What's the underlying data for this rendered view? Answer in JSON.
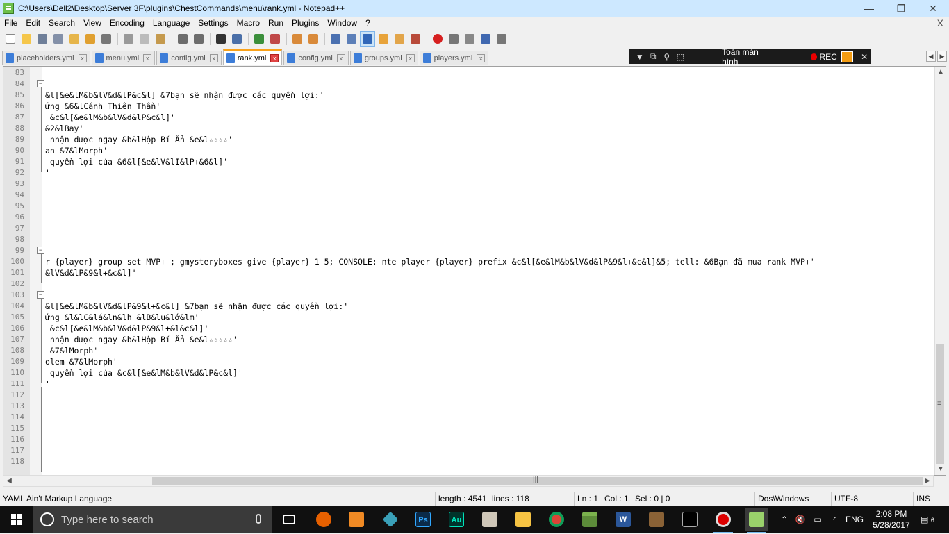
{
  "window": {
    "title": "C:\\Users\\Dell2\\Desktop\\Server 3F\\plugins\\ChestCommands\\menu\\rank.yml - Notepad++",
    "minimize": "—",
    "restore": "❐",
    "close": "✕"
  },
  "menu": [
    "File",
    "Edit",
    "Search",
    "View",
    "Encoding",
    "Language",
    "Settings",
    "Macro",
    "Run",
    "Plugins",
    "Window",
    "?"
  ],
  "menu_close": "X",
  "tabs": [
    {
      "label": "placeholders.yml",
      "active": false
    },
    {
      "label": "menu.yml",
      "active": false
    },
    {
      "label": "config.yml",
      "active": false
    },
    {
      "label": "rank.yml",
      "active": true
    },
    {
      "label": "config.yml",
      "active": false
    },
    {
      "label": "groups.yml",
      "active": false
    },
    {
      "label": "players.yml",
      "active": false
    }
  ],
  "tab_close_glyph": "x",
  "recorder": {
    "fullscreen_label": "Toàn màn hình",
    "rec_label": "REC",
    "close": "✕"
  },
  "editor": {
    "lines": [
      {
        "n": "83",
        "t": ""
      },
      {
        "n": "84",
        "t": ""
      },
      {
        "n": "85",
        "t": "&l[&e&lM&b&lV&d&lP&c&l] &7bạn sẽ nhận được các quyền lợi:'"
      },
      {
        "n": "86",
        "t": "ứng &6&lCánh Thiên Thần'"
      },
      {
        "n": "87",
        "t": " &c&l[&e&lM&b&lV&d&lP&c&l]'"
      },
      {
        "n": "88",
        "t": "&2&lBay'"
      },
      {
        "n": "89",
        "t": " nhận được ngay &b&lHộp Bí Ẩn &e&l☆☆☆☆'"
      },
      {
        "n": "90",
        "t": "an &7&lMorph'"
      },
      {
        "n": "91",
        "t": " quyền lợi của &6&l[&e&lV&lI&lP+&6&l]'"
      },
      {
        "n": "92",
        "t": "'"
      },
      {
        "n": "93",
        "t": ""
      },
      {
        "n": "94",
        "t": ""
      },
      {
        "n": "95",
        "t": ""
      },
      {
        "n": "96",
        "t": ""
      },
      {
        "n": "97",
        "t": ""
      },
      {
        "n": "98",
        "t": ""
      },
      {
        "n": "99",
        "t": ""
      },
      {
        "n": "100",
        "t": "r {player} group set MVP+ ; gmysteryboxes give {player} 1 5; CONSOLE: nte player {player} prefix &c&l[&e&lM&b&lV&d&lP&9&l+&c&l]&5; tell: &6Bạn đã mua rank MVP+'"
      },
      {
        "n": "101",
        "t": "&lV&d&lP&9&l+&c&l]'"
      },
      {
        "n": "102",
        "t": ""
      },
      {
        "n": "103",
        "t": ""
      },
      {
        "n": "104",
        "t": "&l[&e&lM&b&lV&d&lP&9&l+&c&l] &7bạn sẽ nhận được các quyền lợi:'"
      },
      {
        "n": "105",
        "t": "ứng &l&lC&lá&ln&lh &lB&lu&lớ&lm'"
      },
      {
        "n": "106",
        "t": " &c&l[&e&lM&b&lV&d&lP&9&l+&l&c&l]'"
      },
      {
        "n": "107",
        "t": " nhận được ngay &b&lHộp Bí Ẩn &e&l☆☆☆☆☆'"
      },
      {
        "n": "108",
        "t": " &7&lMorph'"
      },
      {
        "n": "109",
        "t": "olem &7&lMorph'"
      },
      {
        "n": "110",
        "t": " quyền lợi của &c&l[&e&lM&b&lV&d&lP&c&l]'"
      },
      {
        "n": "111",
        "t": "'"
      },
      {
        "n": "112",
        "t": ""
      },
      {
        "n": "113",
        "t": ""
      },
      {
        "n": "114",
        "t": ""
      },
      {
        "n": "115",
        "t": ""
      },
      {
        "n": "116",
        "t": ""
      },
      {
        "n": "117",
        "t": ""
      },
      {
        "n": "118",
        "t": ""
      }
    ],
    "fold_markers": [
      "84",
      "99",
      "103"
    ]
  },
  "status": {
    "language": "YAML Ain't Markup Language",
    "length": "length : 4541",
    "lines": "lines : 118",
    "ln": "Ln : 1",
    "col": "Col : 1",
    "sel": "Sel : 0 | 0",
    "eol": "Dos\\Windows",
    "encoding": "UTF-8",
    "mode": "INS"
  },
  "taskbar": {
    "search_placeholder": "Type here to search",
    "language": "ENG",
    "time": "2:08 PM",
    "date": "5/28/2017",
    "notifications": "6"
  }
}
